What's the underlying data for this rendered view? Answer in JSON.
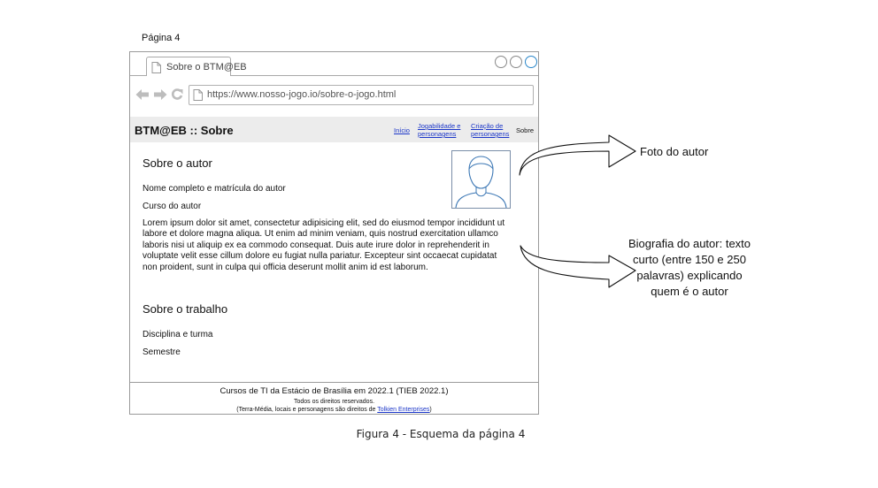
{
  "page_label": "Página 4",
  "browser": {
    "tab_title": "Sobre o BTM@EB",
    "url": "https://www.nosso-jogo.io/sobre-o-jogo.html"
  },
  "site": {
    "title": "BTM@EB :: Sobre",
    "nav": {
      "inicio": "Início",
      "jogabilidade": "Jogabilidade e personagens",
      "criacao": "Criação de personagens",
      "sobre": "Sobre"
    }
  },
  "author": {
    "heading": "Sobre o autor",
    "name": "Nome completo e matrícula do autor",
    "course": "Curso do autor",
    "bio": "Lorem ipsum dolor sit amet, consectetur adipisicing elit, sed do eiusmod tempor incididunt ut labore et dolore magna aliqua. Ut enim ad minim veniam, quis nostrud exercitation ullamco laboris nisi ut aliquip ex ea commodo consequat. Duis aute irure dolor in reprehenderit in voluptate velit esse cillum dolore eu fugiat nulla pariatur. Excepteur sint occaecat cupidatat non proident, sunt in culpa qui officia deserunt mollit anim id est laborum."
  },
  "work": {
    "heading": "Sobre o trabalho",
    "discipline": "Disciplina e turma",
    "semester": "Semestre"
  },
  "footer": {
    "line1": "Cursos de TI da Estácio de Brasília em 2022.1 (TIEB 2022.1)",
    "line2": "Todos os direitos reservados.",
    "line3_prefix": "(Terra-Média, locais e personagens são direitos de ",
    "line3_link": "Tolkien Enterprises",
    "line3_suffix": ")"
  },
  "annotations": {
    "photo": "Foto do autor",
    "bio": "Biografia do autor: texto curto (entre 150 e 250 palavras) explicando quem é o autor"
  },
  "figure_caption": "Figura 4 - Esquema da página 4",
  "icons": {
    "tab": "document-icon",
    "back": "back-arrow-icon",
    "forward": "forward-arrow-icon",
    "reload": "reload-icon",
    "url": "document-icon",
    "photo": "user-avatar-icon"
  },
  "colors": {
    "link": "#1a35c8",
    "header_bg": "#ececec",
    "window_close_accent": "#2a86c9"
  }
}
